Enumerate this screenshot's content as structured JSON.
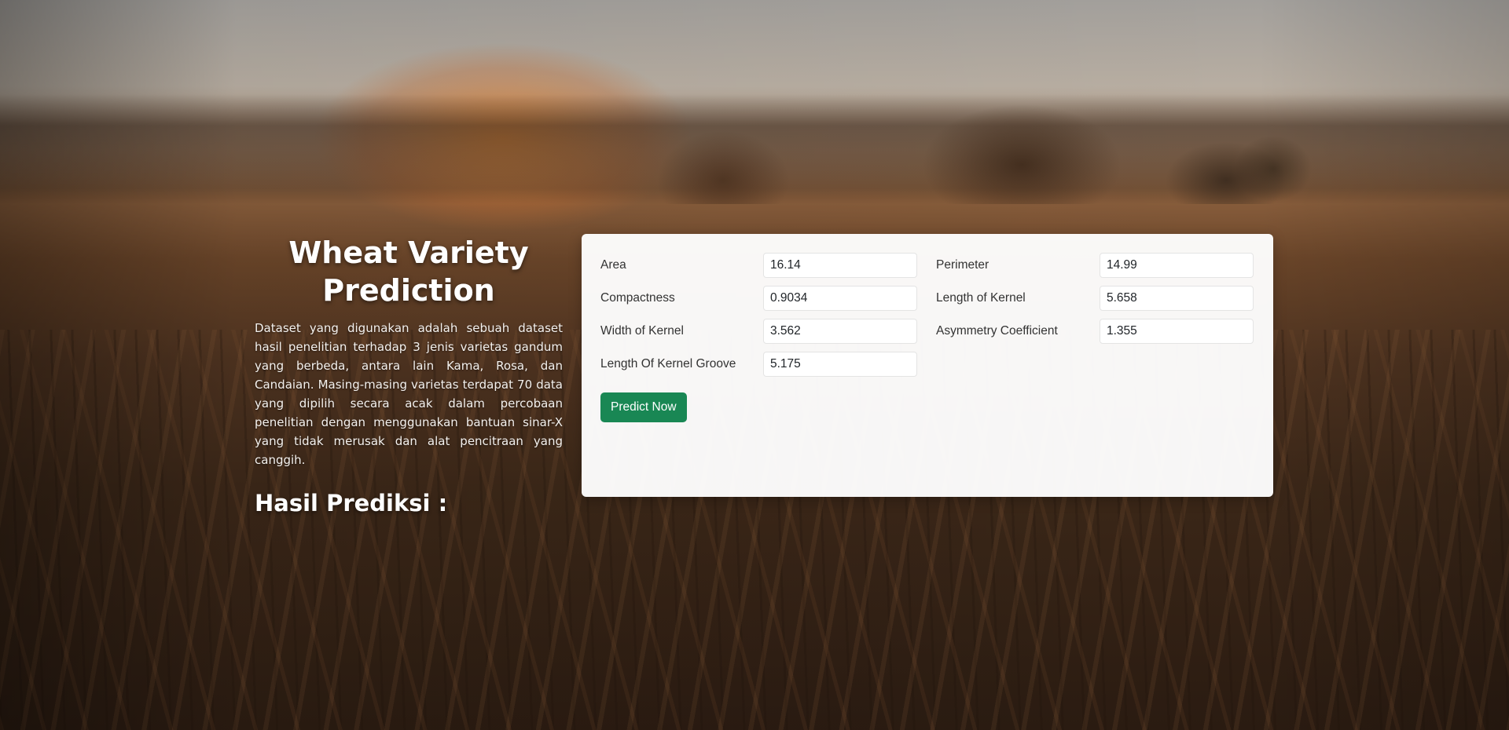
{
  "header": {
    "title_line1": "Wheat Variety",
    "title_line2": "Prediction",
    "description": "Dataset yang digunakan adalah sebuah dataset hasil penelitian terhadap 3 jenis varietas gandum yang berbeda, antara lain Kama, Rosa, dan Candaian. Masing-masing varietas terdapat 70 data yang dipilih secara acak dalam percobaan penelitian dengan menggunakan bantuan sinar-X yang tidak merusak dan alat pencitraan yang canggih.",
    "result_title": "Hasil Prediksi :"
  },
  "form": {
    "area": {
      "label": "Area",
      "value": "16.14"
    },
    "perimeter": {
      "label": "Perimeter",
      "value": "14.99"
    },
    "compactness": {
      "label": "Compactness",
      "value": "0.9034"
    },
    "length_of_kernel": {
      "label": "Length of Kernel",
      "value": "5.658"
    },
    "width_of_kernel": {
      "label": "Width of Kernel",
      "value": "3.562"
    },
    "asymmetry_coefficient": {
      "label": "Asymmetry Coefficient",
      "value": "1.355"
    },
    "length_of_kernel_groove": {
      "label": "Length Of Kernel Groove",
      "value": "5.175"
    },
    "submit_label": "Predict Now"
  },
  "colors": {
    "accent": "#198754",
    "card_background": "#f7f7f7"
  }
}
